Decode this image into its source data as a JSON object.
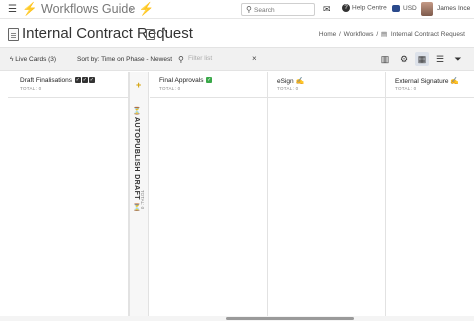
{
  "topbar": {
    "menu_icon": "hamburger-icon",
    "app_title": "⚡ Workflows Guide ⚡",
    "search_placeholder": "Search",
    "help_label": "Help Centre",
    "currency": "USD",
    "user_name": "James Ince"
  },
  "header": {
    "title": "Internal Contract Request",
    "breadcrumb": [
      "Home",
      "Workflows",
      "Internal Contract Request"
    ]
  },
  "toolbar": {
    "live_cards": "Live Cards (3)",
    "sort_by": "Sort by: Time on Phase - Newest",
    "filter_placeholder": "Filter list"
  },
  "board": {
    "columns": [
      {
        "title": "Draft Finalisations",
        "total": "TOTAL: 0"
      },
      {
        "title": "Final Approvals",
        "total": "TOTAL: 0"
      },
      {
        "title": "eSign",
        "total": "TOTAL: 0"
      },
      {
        "title": "External Signature",
        "total": "TOTAL: 0"
      }
    ],
    "collapsed": {
      "title": "⏳ AUTOPUBLISH DRAFT ⏳",
      "total": "TOTAL: 0"
    }
  },
  "colors": {
    "accent_bolt": "#f5b400",
    "check_green": "#3aa849",
    "plus_gold": "#d4a106"
  }
}
